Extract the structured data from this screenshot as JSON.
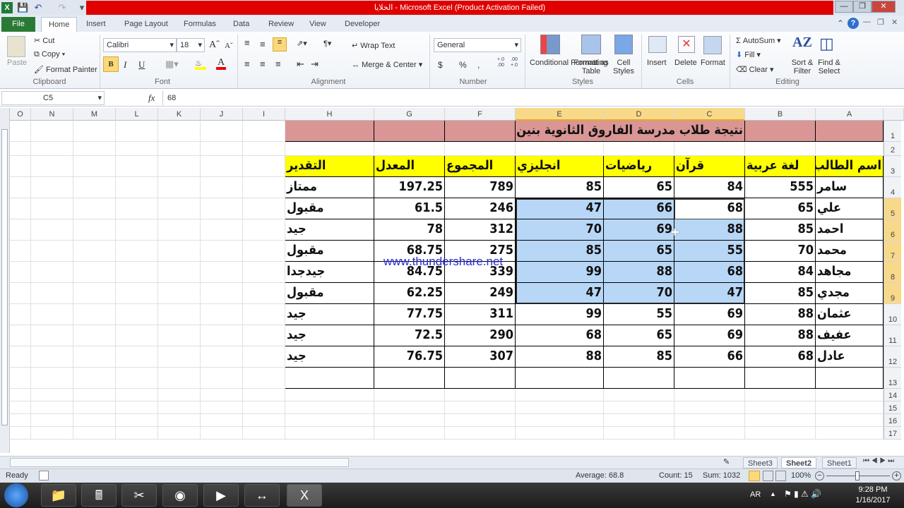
{
  "window": {
    "title": "الخلايا  -  Microsoft Excel (Product Activation Failed)",
    "controls": [
      "minimize",
      "restore",
      "close"
    ]
  },
  "ribbon_tabs": [
    "File",
    "Home",
    "Insert",
    "Page Layout",
    "Formulas",
    "Data",
    "Review",
    "View",
    "Developer"
  ],
  "ribbon": {
    "clipboard": {
      "paste": "Paste",
      "cut": "Cut",
      "copy": "Copy",
      "format_painter": "Format Painter",
      "label": "Clipboard"
    },
    "font": {
      "name": "Calibri",
      "size": "18",
      "bold": "B",
      "italic": "I",
      "underline": "U",
      "label": "Font"
    },
    "alignment": {
      "wrap_text": "Wrap Text",
      "merge_center": "Merge & Center",
      "label": "Alignment"
    },
    "number": {
      "format": "General",
      "currency": "$",
      "percent": "%",
      "comma": ",",
      "inc_decimal": "+.0 .00",
      "dec_decimal": ".00 +.0",
      "label": "Number"
    },
    "styles": {
      "conditional": "Conditional Formatting",
      "format_table": "Format as Table",
      "cell_styles": "Cell Styles",
      "label": "Styles"
    },
    "cells": {
      "insert": "Insert",
      "delete": "Delete",
      "format": "Format",
      "label": "Cells"
    },
    "editing": {
      "autosum": "AutoSum",
      "fill": "Fill",
      "clear": "Clear",
      "sort": "Sort & Filter",
      "find": "Find & Select",
      "label": "Editing"
    }
  },
  "formula_bar": {
    "name_box": "C5",
    "fx": "fx",
    "value": "68"
  },
  "columns": [
    "A",
    "B",
    "C",
    "D",
    "E",
    "F",
    "G",
    "H",
    "I",
    "J",
    "K",
    "L",
    "M",
    "N",
    "O"
  ],
  "rows": [
    "1",
    "2",
    "3",
    "4",
    "5",
    "6",
    "7",
    "8",
    "9",
    "10",
    "11",
    "12",
    "13",
    "14",
    "15",
    "16",
    "17"
  ],
  "sheet": {
    "title": "نتيجة طلاب مدرسة الفاروق الثانوية بنين",
    "headers": [
      "اسم الطالب",
      "لغة عربية",
      "قرآن",
      "رياضيات",
      "انجليزي",
      "المجموع",
      "المعدل",
      "التقدير"
    ],
    "records": [
      [
        "سامر",
        "555",
        "84",
        "65",
        "85",
        "789",
        "197.25",
        "ممتاز"
      ],
      [
        "علي",
        "65",
        "68",
        "66",
        "47",
        "246",
        "61.5",
        "مقبول"
      ],
      [
        "احمد",
        "85",
        "88",
        "69",
        "70",
        "312",
        "78",
        "جيد"
      ],
      [
        "محمد",
        "70",
        "55",
        "65",
        "85",
        "275",
        "68.75",
        "مقبول"
      ],
      [
        "مجاهد",
        "84",
        "68",
        "88",
        "99",
        "339",
        "84.75",
        "جيدجدا"
      ],
      [
        "مجدي",
        "85",
        "47",
        "70",
        "47",
        "249",
        "62.25",
        "مقبول"
      ],
      [
        "عثمان",
        "88",
        "69",
        "55",
        "99",
        "311",
        "77.75",
        "جيد"
      ],
      [
        "عفيف",
        "88",
        "69",
        "65",
        "68",
        "290",
        "72.5",
        "جيد"
      ],
      [
        "عادل",
        "68",
        "66",
        "85",
        "88",
        "307",
        "76.75",
        "جيد"
      ]
    ],
    "title_fill": "#d99694",
    "header_fill": "#ffff00",
    "selection_fill": "#b8d7f7",
    "selected_range": "C5:E9",
    "active_cell": "C5"
  },
  "watermark": "www.thundershare.net",
  "sheet_tabs": [
    "Sheet3",
    "Sheet2",
    "Sheet1"
  ],
  "active_sheet": "Sheet2",
  "status": {
    "ready": "Ready",
    "average": "Average: 68.8",
    "count": "Count: 15",
    "sum": "Sum: 1032",
    "zoom": "100%"
  },
  "taskbar": {
    "lang": "AR",
    "time": "9:28 PM",
    "date": "1/16/2017"
  }
}
